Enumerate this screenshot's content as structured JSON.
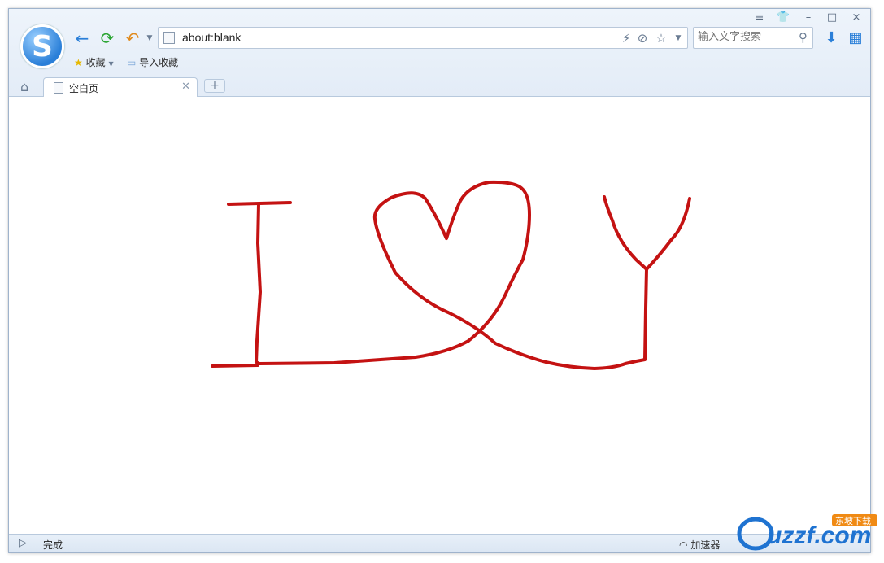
{
  "browser": {
    "logo_letter": "S",
    "window_controls": [
      "≡",
      "👕",
      "–",
      "□",
      "×"
    ]
  },
  "toolbar": {
    "back_icon": "←",
    "refresh_icon": "⟳",
    "undo_icon": "↶",
    "url": "about:blank",
    "search_placeholder": "输入文字搜索",
    "download_icon": "⬇",
    "apps_icon": "▦"
  },
  "favorites": {
    "bookmarks_label": "收藏",
    "import_label": "导入收藏"
  },
  "tabs": [
    {
      "label": "空白页"
    }
  ],
  "status": {
    "text": "完成",
    "accelerator_label": "加速器"
  },
  "drawing": {
    "stroke_color": "#c41212",
    "text_meaning": "I ♥ Y"
  },
  "watermark": {
    "text": "uzzf.com",
    "badge": "东坡下载"
  },
  "colors": {
    "chrome_bg": "#e3ecf7",
    "accent_blue": "#2a7fd8",
    "refresh_green": "#2aa532",
    "undo_orange": "#e08a1c"
  }
}
